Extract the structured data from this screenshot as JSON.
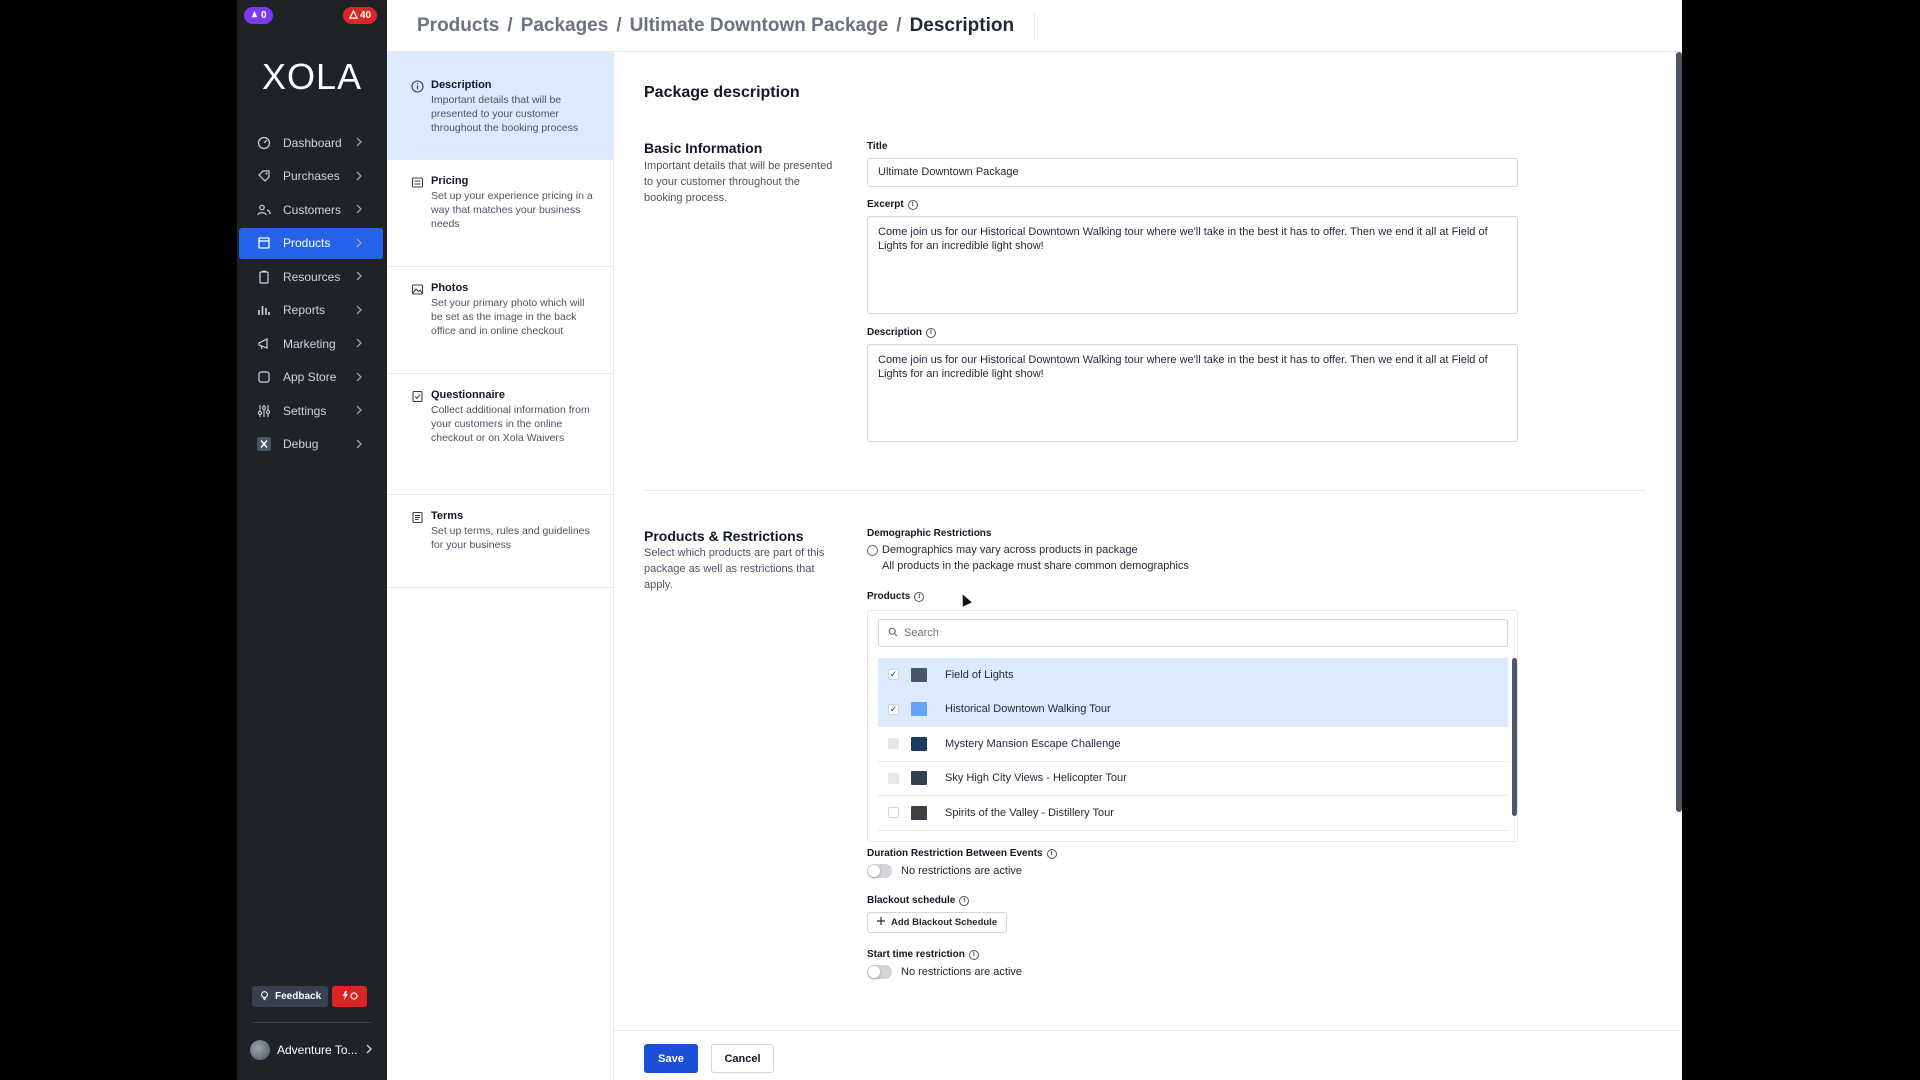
{
  "badges": {
    "left": "0",
    "right": "40"
  },
  "logo": "XOLA",
  "nav": [
    {
      "label": "Dashboard",
      "icon": "dashboard-icon"
    },
    {
      "label": "Purchases",
      "icon": "tag-icon"
    },
    {
      "label": "Customers",
      "icon": "users-icon"
    },
    {
      "label": "Products",
      "icon": "box-icon",
      "active": true
    },
    {
      "label": "Resources",
      "icon": "clipboard-icon"
    },
    {
      "label": "Reports",
      "icon": "bar-chart-icon"
    },
    {
      "label": "Marketing",
      "icon": "megaphone-icon"
    },
    {
      "label": "App Store",
      "icon": "app-store-icon"
    },
    {
      "label": "Settings",
      "icon": "sliders-icon"
    },
    {
      "label": "Debug",
      "icon": "debug-icon"
    }
  ],
  "feedback_label": "Feedback",
  "account_label": "Adventure To...",
  "breadcrumb": [
    "Products",
    "Packages",
    "Ultimate Downtown Package",
    "Description"
  ],
  "steps": [
    {
      "title": "Description",
      "desc": "Important details that will be presented to your customer throughout the booking process"
    },
    {
      "title": "Pricing",
      "desc": "Set up your experience pricing in a way that matches your business needs"
    },
    {
      "title": "Photos",
      "desc": "Set your primary photo which will be set as the image in the back office and in online checkout"
    },
    {
      "title": "Questionnaire",
      "desc": "Collect additional information from your customers in the online checkout or on Xola Waivers"
    },
    {
      "title": "Terms",
      "desc": "Set up terms, rules and guidelines for your business"
    }
  ],
  "form": {
    "page_title": "Package description",
    "basic_title": "Basic Information",
    "basic_desc": "Important details that will be presented to your customer throughout the booking process.",
    "title_label": "Title",
    "title_value": "Ultimate Downtown Package",
    "excerpt_label": "Excerpt",
    "excerpt_value": "Come join us for our Historical Downtown Walking tour where we'll take in the best it has to offer. Then we end it all at Field of Lights for an incredible light show!",
    "description_label": "Description",
    "description_value": "Come join us for our Historical Downtown Walking tour where we'll take in the best it has to offer. Then we end it all at Field of Lights for an incredible light show!",
    "products_title": "Products & Restrictions",
    "products_desc": "Select which products are part of this package as well as restrictions that apply.",
    "demo_label": "Demographic Restrictions",
    "demo_option1": "Demographics may vary across products in package",
    "demo_option2": "All products in the package must share common demographics",
    "products_label": "Products",
    "search_placeholder": "Search",
    "duration_label": "Duration Restriction Between Events",
    "duration_value": "No restrictions are active",
    "blackout_label": "Blackout schedule",
    "blackout_button": "Add Blackout Schedule",
    "start_label": "Start time restriction",
    "start_value": "No restrictions are active",
    "save": "Save",
    "cancel": "Cancel"
  },
  "products": [
    {
      "name": "Field of Lights",
      "checked": true,
      "thumb": "#475569"
    },
    {
      "name": "Historical Downtown Walking Tour",
      "checked": true,
      "thumb": "#60a5fa"
    },
    {
      "name": "Mystery Mansion Escape Challenge",
      "checked": false,
      "thumb": "#1e3a5f"
    },
    {
      "name": "Sky High City Views - Helicopter Tour",
      "checked": false,
      "thumb": "#334155"
    },
    {
      "name": "Spirits of the Valley - Distillery Tour",
      "checked": false,
      "thumb": "#3f3f46"
    }
  ]
}
